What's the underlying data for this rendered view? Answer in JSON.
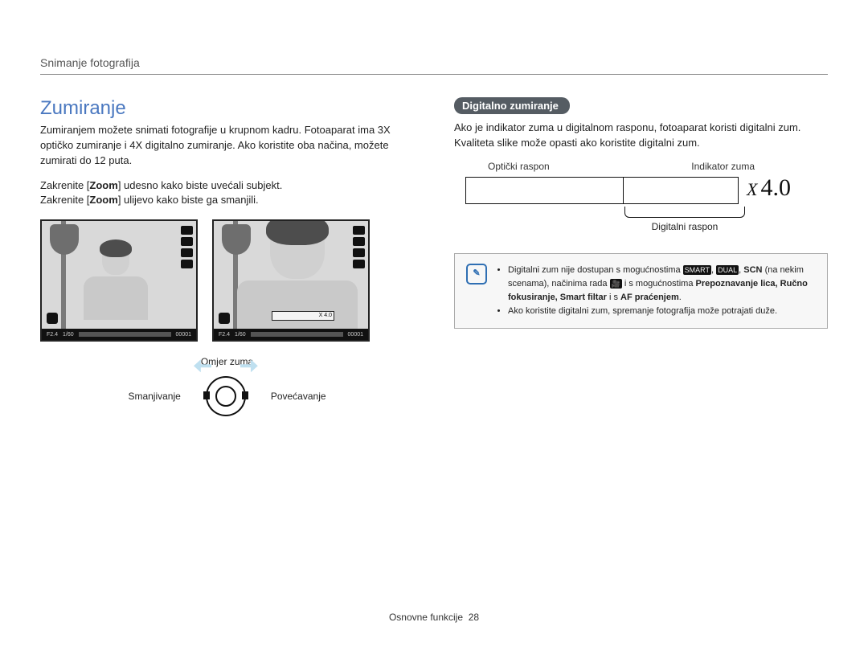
{
  "breadcrumb": "Snimanje fotografija",
  "title": "Zumiranje",
  "intro": "Zumiranjem možete snimati fotografije u krupnom kadru. Fotoaparat ima 3X optičko zumiranje i 4X digitalno zumiranje. Ako koristite oba načina, možete zumirati do 12 puta.",
  "instr_prefix1": "Zakrenite [",
  "instr_bold": "Zoom",
  "instr_suffix1": "] udesno kako biste uvećali subjekt.",
  "instr_prefix2": "Zakrenite [",
  "instr_suffix2": "] ulijevo kako biste ga smanjili.",
  "preview": {
    "aperture": "F2.4",
    "shutter": "1/60",
    "counter": "00001",
    "zoom_overlay": "X 4.0"
  },
  "labels": {
    "zoom_ratio": "Omjer zuma",
    "decrease": "Smanjivanje",
    "increase": "Povećavanje"
  },
  "right": {
    "section": "Digitalno zumiranje",
    "body": "Ako je indikator zuma u digitalnom rasponu, fotoaparat koristi digitalni zum. Kvaliteta slike može opasti ako koristite digitalni zum.",
    "optical_label": "Optički raspon",
    "indicator_label": "Indikator zuma",
    "digital_label": "Digitalni raspon",
    "value_x": "X",
    "value_num": "4.0"
  },
  "note": {
    "line1_a": "Digitalni zum nije dostupan s mogućnostima ",
    "icon_smart": "SMART",
    "sep": ", ",
    "icon_dual": "DUAL",
    "line1_b": ", ",
    "scn": "SCN",
    "line1_c": " (na nekim scenama), načinima rada ",
    "icon_movie": "🎥",
    "line1_d": " i s mogućnostima ",
    "bold_list": "Prepoznavanje lica, Ručno fokusiranje, Smart filtar",
    "line1_e": " i s ",
    "bold_af": "AF praćenjem",
    "period": ".",
    "line2": "Ako koristite digitalni zum, spremanje fotografija može potrajati duže."
  },
  "footer_text": "Osnovne funkcije",
  "page_number": "28"
}
